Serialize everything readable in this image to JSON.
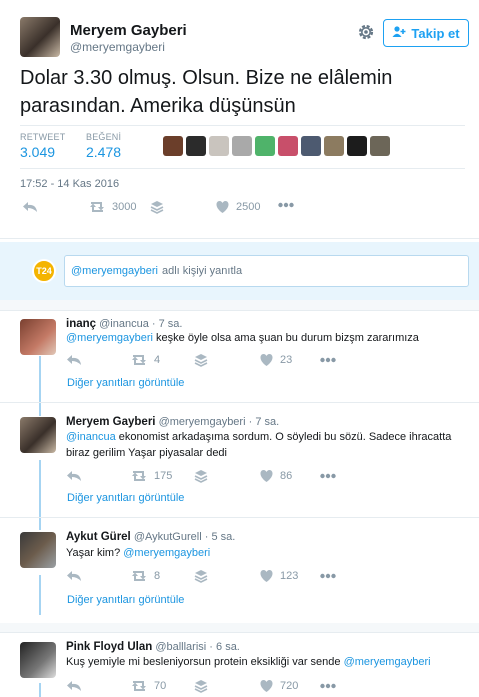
{
  "tweet": {
    "author_name": "Meryem Gayberi",
    "author_handle": "@meryemgayberi",
    "follow_label": "Takip et",
    "text": "Dolar 3.30 olmuş. Olsun. Bize ne elâlemin parasından. Amerika düşünsün",
    "retweet_label": "RETWEET",
    "retweet_count": "3.049",
    "like_label": "BEĞENİ",
    "like_count": "2.478",
    "timestamp": "17:52 - 14 Kas 2016",
    "action_retweets": "3000",
    "action_likes": "2500"
  },
  "reply_box": {
    "mention": "@meryemgayberi",
    "prompt": "adlı kişiyi yanıtla",
    "badge": "T24"
  },
  "replies": [
    {
      "name": "inanç",
      "handle": "@inancua",
      "time": "· 7 sa.",
      "mention": "@meryemgayberi",
      "text": "keşke öyle olsa ama şuan bu durum bizşm zararımıza",
      "retweets": "4",
      "likes": "23",
      "see_replies": "Diğer yanıtları görüntüle"
    },
    {
      "name": "Meryem Gayberi",
      "handle": "@meryemgayberi",
      "time": "· 7 sa.",
      "mention": "@inancua",
      "text": "ekonomist arkadaşıma sordum. O söyledi bu sözü. Sadece ihracatta biraz gerilim Yaşar piyasalar dedi",
      "retweets": "175",
      "likes": "86",
      "see_replies": "Diğer yanıtları görüntüle"
    },
    {
      "name": "Aykut Gürel",
      "handle": "@AykutGurell",
      "time": "· 5 sa.",
      "text_pre": "Yaşar kim?",
      "mention": "@meryemgayberi",
      "retweets": "8",
      "likes": "123",
      "see_replies": "Diğer yanıtları görüntüle"
    },
    {
      "name": "Pink Floyd Ulan",
      "handle": "@balllarisi",
      "time": "· 6 sa.",
      "text": "Kuş yemiyle mi besleniyorsun protein eksikliği var sende",
      "mention": "@meryemgayberi",
      "retweets": "70",
      "likes": "720"
    }
  ],
  "colors": {
    "accent": "#1da1f2",
    "link": "#1b95e0",
    "icon": "#aab8c2",
    "reply_bg": "#e8f5fd",
    "thread": "#a6d4f2"
  },
  "icons": [
    "gear-icon",
    "follow-user-icon",
    "reply-icon",
    "retweet-icon",
    "stack-icon",
    "heart-icon",
    "more-icon"
  ]
}
